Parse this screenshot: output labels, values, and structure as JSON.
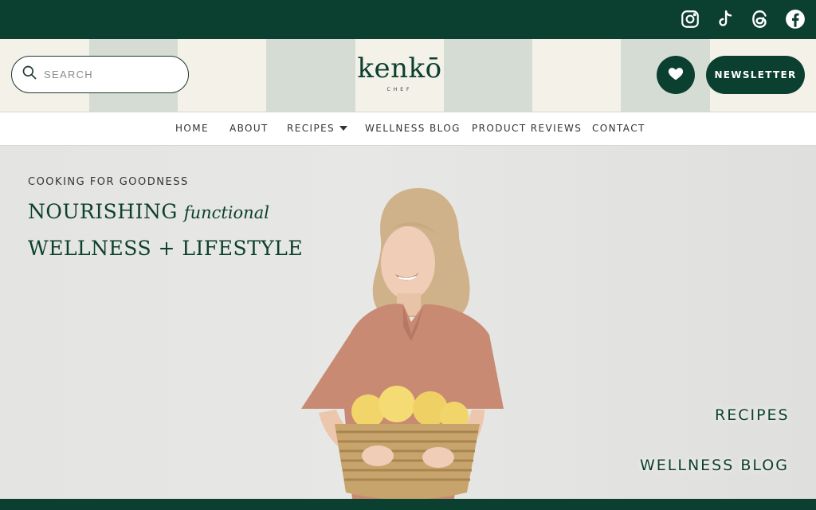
{
  "social": [
    "instagram-icon",
    "tiktok-icon",
    "threads-icon",
    "facebook-icon"
  ],
  "search": {
    "placeholder": "SEARCH"
  },
  "logo": {
    "word": "kenkō",
    "sub": "CHEF"
  },
  "header": {
    "newsletter_label": "NEWSLETTER"
  },
  "nav": {
    "items": [
      {
        "label": "HOME"
      },
      {
        "label": "ABOUT"
      },
      {
        "label": "RECIPES"
      },
      {
        "label": "WELLNESS BLOG"
      },
      {
        "label": "PRODUCT REVIEWS"
      },
      {
        "label": "CONTACT"
      }
    ]
  },
  "hero": {
    "eyebrow": "COOKING FOR GOODNESS",
    "headline_1": "NOURISHING",
    "headline_italic": "functional",
    "headline_2": "WELLNESS + LIFESTYLE",
    "link_recipes": "RECIPES",
    "link_blog": "WELLNESS BLOG"
  },
  "colors": {
    "brand_green": "#0b3f2f",
    "cream": "#f3f1e8",
    "sage": "#d5dcd3"
  }
}
